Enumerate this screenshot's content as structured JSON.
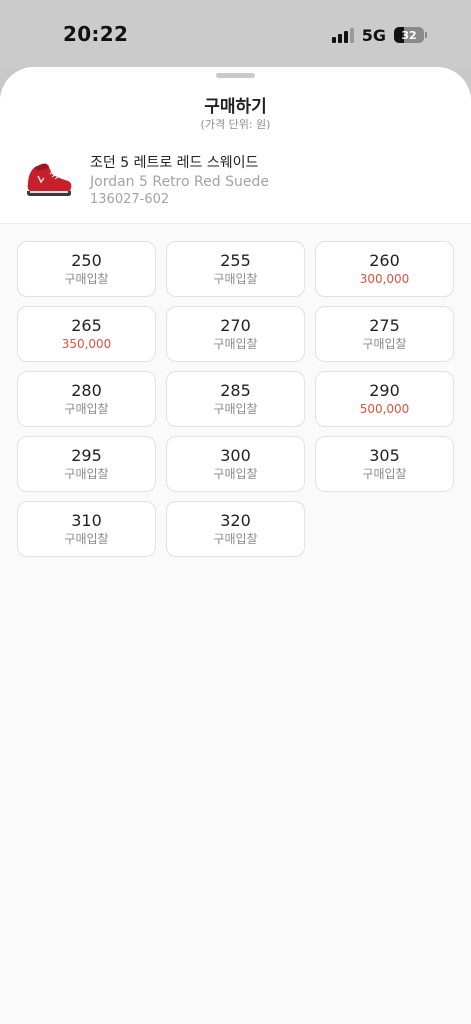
{
  "status_bar": {
    "time": "20:22",
    "network": "5G",
    "battery_level": "32",
    "battery_fraction": 0.32,
    "signal_icon": "cellular-signal-icon",
    "battery_icon": "battery-icon"
  },
  "sheet": {
    "title": "구매하기",
    "subtitle": "(가격 단위: 원)"
  },
  "product": {
    "name_ko": "조던 5 레트로 레드 스웨이드",
    "name_en": "Jordan 5 Retro Red Suede",
    "code": "136027-602",
    "image_icon": "sneaker-image"
  },
  "sizes": [
    {
      "size": "250",
      "price": "구매입찰",
      "has_price": false
    },
    {
      "size": "255",
      "price": "구매입찰",
      "has_price": false
    },
    {
      "size": "260",
      "price": "300,000",
      "has_price": true
    },
    {
      "size": "265",
      "price": "350,000",
      "has_price": true
    },
    {
      "size": "270",
      "price": "구매입찰",
      "has_price": false
    },
    {
      "size": "275",
      "price": "구매입찰",
      "has_price": false
    },
    {
      "size": "280",
      "price": "구매입찰",
      "has_price": false
    },
    {
      "size": "285",
      "price": "구매입찰",
      "has_price": false
    },
    {
      "size": "290",
      "price": "500,000",
      "has_price": true
    },
    {
      "size": "295",
      "price": "구매입찰",
      "has_price": false
    },
    {
      "size": "300",
      "price": "구매입찰",
      "has_price": false
    },
    {
      "size": "305",
      "price": "구매입찰",
      "has_price": false
    },
    {
      "size": "310",
      "price": "구매입찰",
      "has_price": false
    },
    {
      "size": "320",
      "price": "구매입찰",
      "has_price": false
    }
  ],
  "colors": {
    "price_accent": "#e0523b",
    "bid_text": "#8c8c8c"
  }
}
